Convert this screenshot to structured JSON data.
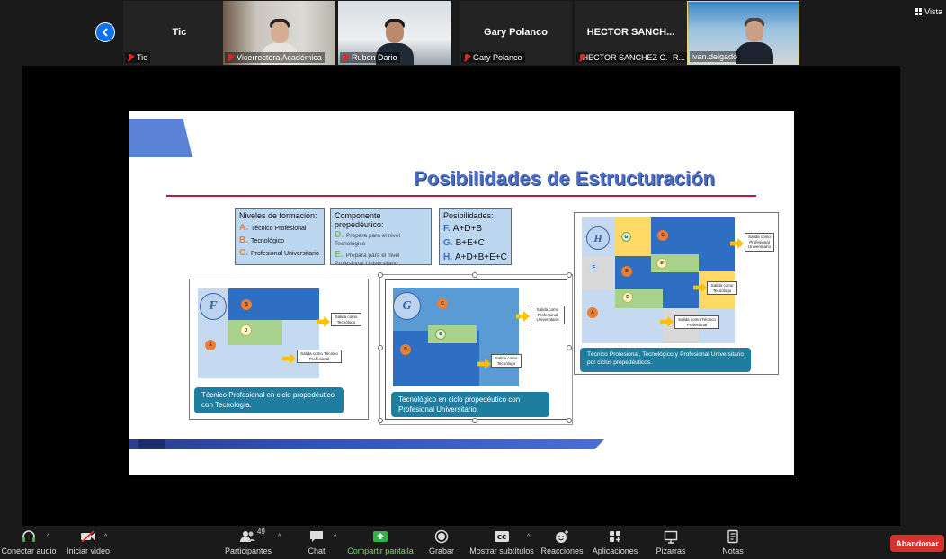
{
  "view_button": "Vista",
  "participants_strip": [
    {
      "name": "Tic",
      "label": "Tic",
      "video": false
    },
    {
      "name": "",
      "label": "Vicerrectora Académica",
      "video": true
    },
    {
      "name": "",
      "label": "Ruben Dario",
      "video": true
    },
    {
      "name": "Gary Polanco",
      "label": "Gary Polanco",
      "video": false
    },
    {
      "name": "HECTOR  SANCH...",
      "label": "HECTOR SANCHEZ C.- R...",
      "video": false
    },
    {
      "name": "",
      "label": "ivan.delgado",
      "video": true
    }
  ],
  "slide": {
    "title": "Posibilidades de Estructuración",
    "niveles": {
      "heading": "Niveles de formación:",
      "items": [
        {
          "letter": "A.",
          "text": "Técnico Profesional"
        },
        {
          "letter": "B.",
          "text": "Tecnológico"
        },
        {
          "letter": "C.",
          "text": "Profesional Universitario"
        }
      ]
    },
    "componente": {
      "heading": "Componente propedéutico:",
      "items": [
        {
          "letter": "D.",
          "text": "Prepara para el nivel Tecnológico"
        },
        {
          "letter": "E.",
          "text": "Prepara para el nivel Profesional Universitario"
        }
      ]
    },
    "posibilidades": {
      "heading": "Posibilidades:",
      "items": [
        {
          "letter": "F.",
          "text": "A+D+B"
        },
        {
          "letter": "G.",
          "text": "B+E+C"
        },
        {
          "letter": "H.",
          "text": "A+D+B+E+C"
        }
      ]
    },
    "diagram_f": {
      "label": "F",
      "circles": [
        "B",
        "D",
        "A"
      ],
      "out1": "Salida como Tecnólogo",
      "out2": "Salida como Técnico Profesional",
      "caption": "Técnico Profesional en ciclo propedéutico con Tecnología."
    },
    "diagram_g": {
      "label": "G",
      "circles": [
        "C",
        "E",
        "B"
      ],
      "out1": "Salida como Profesional Universitario",
      "out2": "Salida como Tecnólogo",
      "caption": "Tecnológico en ciclo propedéutico con Profesional Universitario."
    },
    "diagram_h": {
      "label": "H",
      "circles": [
        "G",
        "C",
        "F",
        "B",
        "E",
        "D",
        "A"
      ],
      "out1": "Salida como Profesional Universitario",
      "out2": "Salida como Tecnólogo",
      "out3": "Salida como Técnico Profesional",
      "caption": "Técnico Profesional, Tecnológico y Profesional Universitario por ciclos propedéuticos."
    }
  },
  "toolbar": {
    "audio": "Conectar audio",
    "video": "Iniciar video",
    "participants": "Participantes",
    "participants_count": "49",
    "chat": "Chat",
    "share": "Compartir pantalla",
    "record": "Grabar",
    "subtitles": "Mostrar subtítulos",
    "reactions": "Reacciones",
    "apps": "Aplicaciones",
    "whiteboards": "Pizarras",
    "notes": "Notas",
    "leave": "Abandonar"
  }
}
